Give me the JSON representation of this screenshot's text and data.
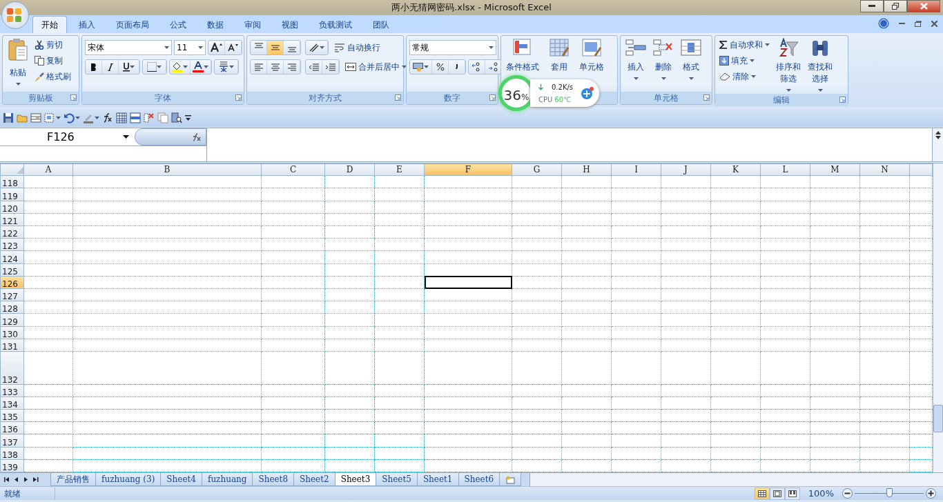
{
  "window": {
    "title": "两小无猜网密码.xlsx - Microsoft Excel"
  },
  "tabs": [
    {
      "label": "开始",
      "selected": true
    },
    {
      "label": "插入",
      "selected": false
    },
    {
      "label": "页面布局",
      "selected": false
    },
    {
      "label": "公式",
      "selected": false
    },
    {
      "label": "数据",
      "selected": false
    },
    {
      "label": "审阅",
      "selected": false
    },
    {
      "label": "视图",
      "selected": false
    },
    {
      "label": "负载测试",
      "selected": false
    },
    {
      "label": "团队",
      "selected": false
    }
  ],
  "clipboard": {
    "paste": "粘贴",
    "cut": "剪切",
    "copy": "复制",
    "format_painter": "格式刷",
    "label": "剪贴板"
  },
  "font": {
    "font_name": "宋体",
    "font_size": "11",
    "label": "字体"
  },
  "alignment": {
    "vertical_align": [
      {
        "selected": false
      },
      {
        "selected": true
      },
      {
        "selected": false
      }
    ],
    "wrap_text": "自动换行",
    "merge_center": "合并后居中",
    "label": "对齐方式"
  },
  "number": {
    "format": "常规",
    "label": "数字"
  },
  "styles": {
    "buttons": [
      "条件格式",
      "套用",
      "单元格"
    ]
  },
  "cells": {
    "buttons": [
      "插入",
      "删除",
      "格式"
    ],
    "label": "单元格"
  },
  "editing": {
    "autosum": "自动求和",
    "fill": "填充",
    "clear": "清除",
    "sort": "排序和筛选",
    "find": "查找和选择",
    "label": "编辑"
  },
  "monitor": {
    "percent": "36",
    "unit": "%",
    "speed": "0.2K/s",
    "cpu_label": "CPU",
    "temp": "60℃"
  },
  "name_box": "F126",
  "grid": {
    "columns": [
      {
        "label": "A",
        "selected": false
      },
      {
        "label": "B",
        "selected": false
      },
      {
        "label": "C",
        "selected": false
      },
      {
        "label": "D",
        "selected": false
      },
      {
        "label": "E",
        "selected": false
      },
      {
        "label": "F",
        "selected": true
      },
      {
        "label": "G",
        "selected": false
      },
      {
        "label": "H",
        "selected": false
      },
      {
        "label": "I",
        "selected": false
      },
      {
        "label": "J",
        "selected": false
      },
      {
        "label": "K",
        "selected": false
      },
      {
        "label": "L",
        "selected": false
      },
      {
        "label": "M",
        "selected": false
      },
      {
        "label": "N",
        "selected": false
      }
    ],
    "rows": [
      {
        "label": "118",
        "selected": false
      },
      {
        "label": "119",
        "selected": false
      },
      {
        "label": "120",
        "selected": false
      },
      {
        "label": "121",
        "selected": false
      },
      {
        "label": "122",
        "selected": false
      },
      {
        "label": "123",
        "selected": false
      },
      {
        "label": "124",
        "selected": false
      },
      {
        "label": "125",
        "selected": false
      },
      {
        "label": "126",
        "selected": true
      },
      {
        "label": "127",
        "selected": false
      },
      {
        "label": "128",
        "selected": false
      },
      {
        "label": "129",
        "selected": false
      },
      {
        "label": "130",
        "selected": false
      },
      {
        "label": "131",
        "selected": false
      },
      {
        "label": "132",
        "selected": false
      },
      {
        "label": "133",
        "selected": false
      },
      {
        "label": "134",
        "selected": false
      },
      {
        "label": "135",
        "selected": false
      },
      {
        "label": "136",
        "selected": false
      },
      {
        "label": "137",
        "selected": false
      },
      {
        "label": "138",
        "selected": false
      },
      {
        "label": "139",
        "selected": false
      }
    ]
  },
  "sheet_tabs": [
    {
      "label": "产品销售",
      "selected": false
    },
    {
      "label": "fuzhuang (3)",
      "selected": false
    },
    {
      "label": "Sheet4",
      "selected": false
    },
    {
      "label": "fuzhuang",
      "selected": false
    },
    {
      "label": "Sheet8",
      "selected": false
    },
    {
      "label": "Sheet2",
      "selected": false
    },
    {
      "label": "Sheet3",
      "selected": true
    },
    {
      "label": "Sheet5",
      "selected": false
    },
    {
      "label": "Sheet1",
      "selected": false
    },
    {
      "label": "Sheet6",
      "selected": false
    }
  ],
  "status_bar": {
    "status": "就绪",
    "view_modes": [
      {
        "selected": true
      },
      {
        "selected": false
      },
      {
        "selected": false
      }
    ],
    "zoom": "100%",
    "zoom_slider": {
      "level": 0.5
    }
  }
}
